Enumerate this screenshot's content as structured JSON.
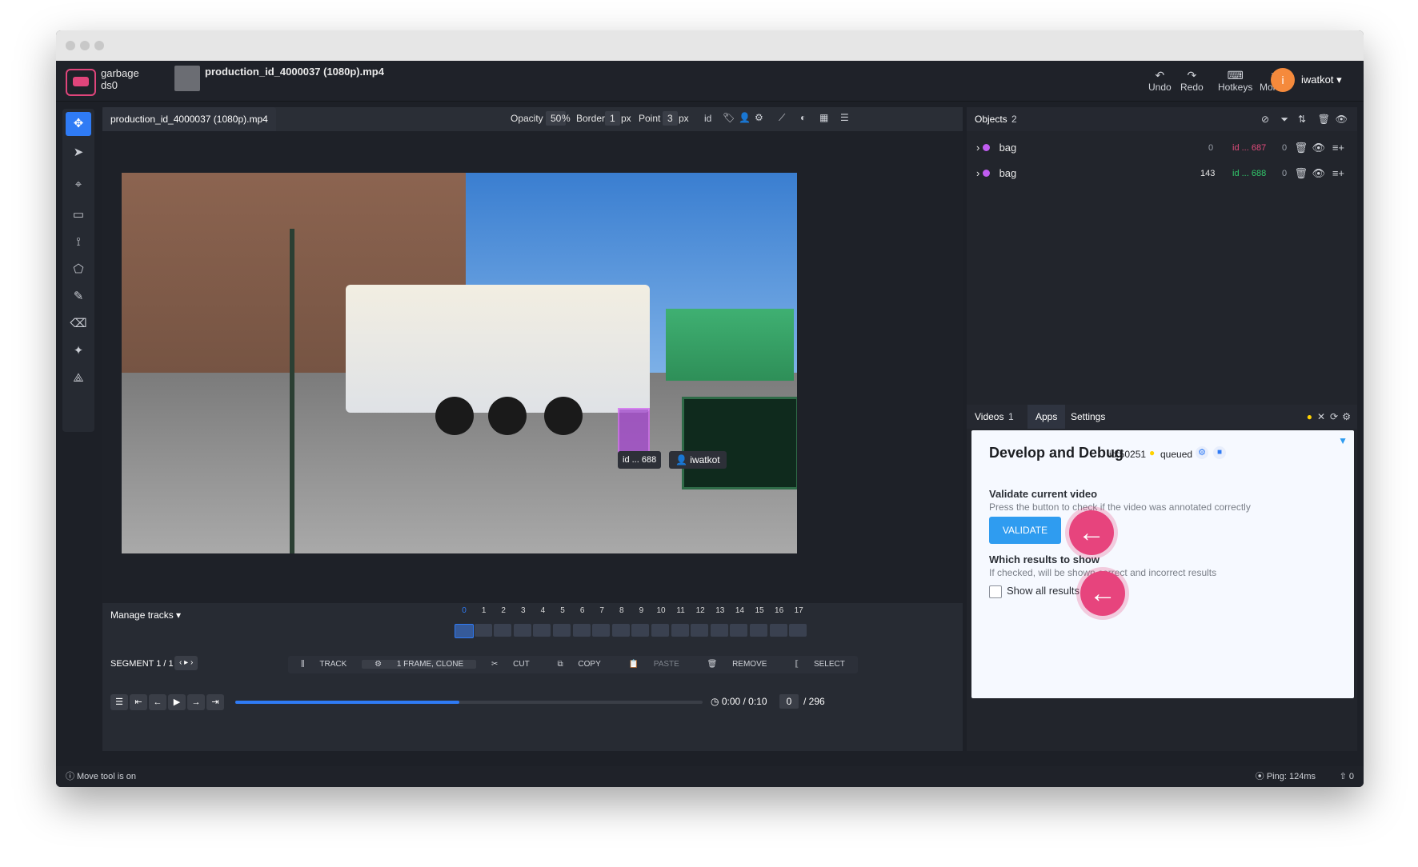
{
  "window": {
    "title": "",
    "chrome": {
      "dots": [
        "",
        "",
        ""
      ]
    }
  },
  "topbar": {
    "breadcrumb": {
      "project": "garbage",
      "dataset": "ds0",
      "file": "production_id_4000037 (1080p).mp4"
    },
    "buttons": {
      "undo": "Undo",
      "redo": "Redo",
      "hotkeys": "Hotkeys",
      "more": "More"
    },
    "user": {
      "initial": "i",
      "name": "iwatkot"
    }
  },
  "left_toolbar": {
    "tools": [
      {
        "icon": "move-icon",
        "active": true
      },
      {
        "icon": "pointer-icon",
        "active": false
      },
      {
        "icon": "skeleton-icon",
        "active": false
      },
      {
        "icon": "rectangle-icon",
        "active": false
      },
      {
        "icon": "polyline-icon",
        "active": false
      },
      {
        "icon": "polygon-icon",
        "active": false
      },
      {
        "icon": "brush-icon",
        "active": false
      },
      {
        "icon": "eraser-icon",
        "active": false
      },
      {
        "icon": "magic-wand-icon",
        "active": false
      },
      {
        "icon": "graph-icon",
        "active": false
      }
    ]
  },
  "editor": {
    "tab": "production_id_4000037 (1080p).mp4",
    "toolbar": {
      "opacity_label": "Opacity",
      "opacity_value": "50",
      "opacity_unit": "%",
      "border_label": "Border",
      "border_value": "1",
      "border_unit": "px",
      "point_label": "Point",
      "point_value": "3",
      "point_unit": "px"
    },
    "annotation": {
      "id_label": "id ... 688",
      "user": "iwatkot"
    },
    "timeline": {
      "manage_tracks": "Manage tracks",
      "segment": "SEGMENT 1 / 1",
      "frames": [
        "0",
        "1",
        "2",
        "3",
        "4",
        "5",
        "6",
        "7",
        "8",
        "9",
        "10",
        "11",
        "12",
        "13",
        "14",
        "15",
        "16",
        "17"
      ],
      "tools": {
        "track": "TRACK",
        "frame_clone": "1 FRAME, CLONE",
        "cut": "CUT",
        "copy": "COPY",
        "paste": "PASTE",
        "remove": "REMOVE",
        "select": "SELECT"
      },
      "time": "0:00 / 0:10",
      "frame_input": "0",
      "frame_total": "/ 296",
      "progress_fraction": 0.48
    },
    "status": {
      "message": "Move tool is on",
      "ping": "Ping: 124ms",
      "upload": "0"
    }
  },
  "objects_panel": {
    "title": "Objects",
    "count": "2",
    "rows": [
      {
        "name": "bag",
        "stat1": "0",
        "id": "id ... 687",
        "stat2": "0",
        "id_color": "#e04b7b"
      },
      {
        "name": "bag",
        "stat1": "143",
        "id": "id ... 688",
        "stat2": "0",
        "id_color": "#32c86b"
      }
    ]
  },
  "apps_panel": {
    "tabs": [
      "Videos",
      "1",
      "Apps",
      "Settings"
    ],
    "app": {
      "title": "Develop and Debug",
      "id_label": "id:50251",
      "status": "queued",
      "validate_section": {
        "title": "Validate current video",
        "description": "Press the button to check if the video was annotated correctly",
        "button": "VALIDATE"
      },
      "results_section": {
        "title": "Which results to show",
        "description": "If checked, will be shown correct and incorrect results",
        "checkbox_label": "Show all results",
        "checked": false
      }
    }
  }
}
